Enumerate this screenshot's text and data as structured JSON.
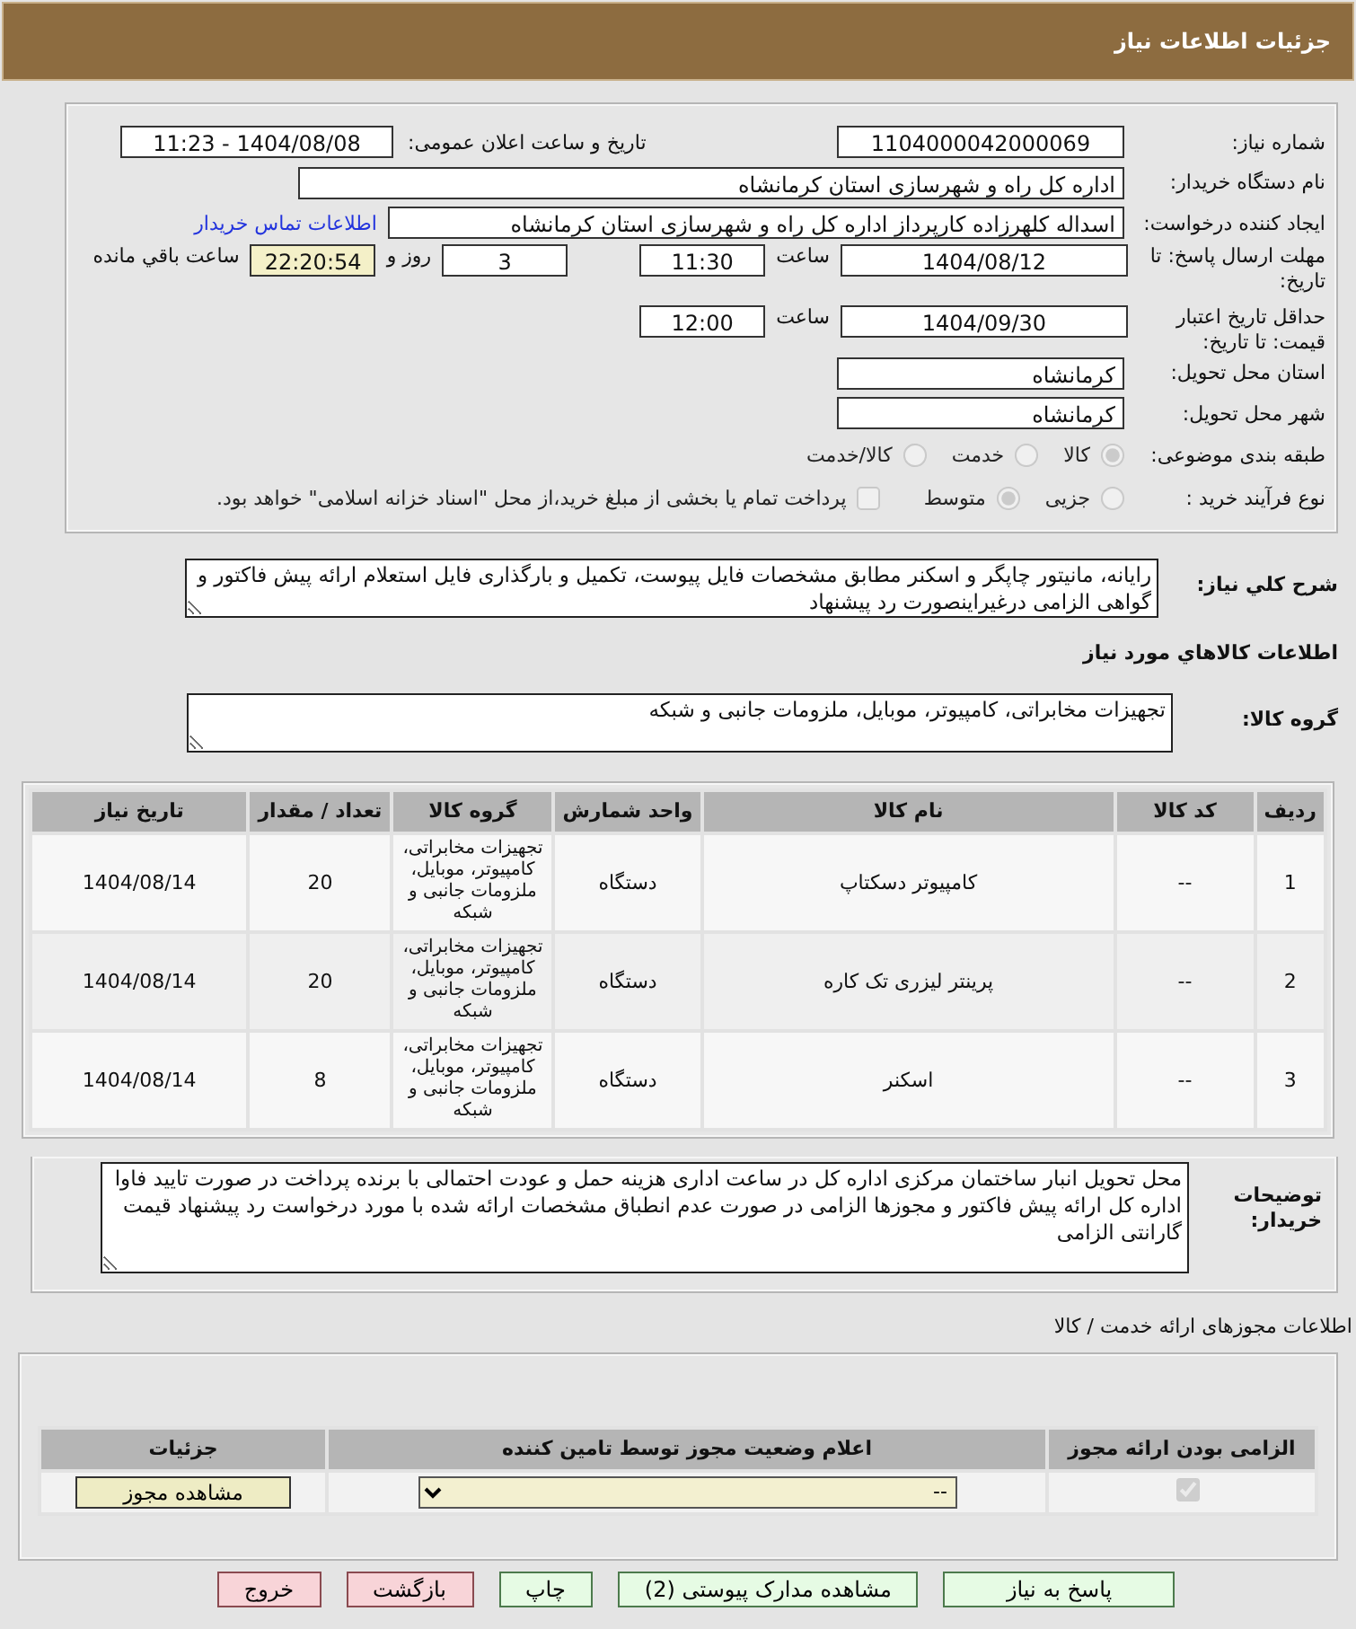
{
  "header": {
    "title": "جزئیات اطلاعات نیاز"
  },
  "form": {
    "need_number": {
      "label": "شماره نیاز:",
      "value": "1104000042000069"
    },
    "announce": {
      "label": "تاریخ و ساعت اعلان عمومی:",
      "value": "1404/08/08 - 11:23"
    },
    "buyer": {
      "label": "نام دستگاه خریدار:",
      "value": "اداره کل راه و شهرسازی استان کرمانشاه"
    },
    "requester": {
      "label": "ایجاد کننده درخواست:",
      "value": "اسداله کلهرزاده کارپرداز اداره کل راه و شهرسازی استان کرمانشاه",
      "link": "اطلاعات تماس خریدار"
    },
    "deadline": {
      "label": "مهلت ارسال پاسخ: تا تاریخ:",
      "date": "1404/08/12",
      "time_label": "ساعت",
      "time": "11:30",
      "days": "3",
      "days_label": "روز و",
      "remaining": "22:20:54",
      "remaining_label": "ساعت باقي مانده"
    },
    "validity": {
      "label": "حداقل تاریخ اعتبار قیمت: تا تاریخ:",
      "date": "1404/09/30",
      "time_label": "ساعت",
      "time": "12:00"
    },
    "province": {
      "label": "استان محل تحویل:",
      "value": "کرمانشاه"
    },
    "city": {
      "label": "شهر محل تحویل:",
      "value": "کرمانشاه"
    },
    "category": {
      "label": "طبقه بندی موضوعی:",
      "options": [
        {
          "label": "کالا",
          "selected": true
        },
        {
          "label": "خدمت",
          "selected": false
        },
        {
          "label": "کالا/خدمت",
          "selected": false
        }
      ]
    },
    "process": {
      "label": "نوع فرآیند خرید :",
      "options": [
        {
          "label": "جزیی",
          "selected": false
        },
        {
          "label": "متوسط",
          "selected": true
        }
      ],
      "payment": {
        "label": "پرداخت تمام یا بخشی از مبلغ خرید،از محل \"اسناد خزانه اسلامی\" خواهد بود.",
        "checked": false
      }
    }
  },
  "description": {
    "label": "شرح کلي نياز:",
    "value": "رایانه، مانیتور چاپگر و اسکنر مطابق مشخصات فایل پیوست، تکمیل و بارگذاری فایل استعلام ارائه پیش فاکتور و گواهی الزامی درغیراینصورت رد پیشنهاد"
  },
  "goods_title": "اطلاعات کالاهاي مورد نياز",
  "goods_group": {
    "label": "گروه کالا:",
    "value": "تجهیزات مخابراتی، کامپیوتر، موبایل، ملزومات جانبی و شبکه"
  },
  "items": {
    "columns": [
      "رديف",
      "کد کالا",
      "نام کالا",
      "واحد شمارش",
      "گروه کالا",
      "تعداد / مقدار",
      "تاریخ نیاز"
    ],
    "rows": [
      [
        "1",
        "--",
        "کامپیوتر دسکتاپ",
        "دستگاه",
        "تجهیزات مخابراتی، کامپیوتر، موبایل، ملزومات جانبی و شبکه",
        "20",
        "1404/08/14"
      ],
      [
        "2",
        "--",
        "پرینتر لیزری تک کاره",
        "دستگاه",
        "تجهیزات مخابراتی، کامپیوتر، موبایل، ملزومات جانبی و شبکه",
        "20",
        "1404/08/14"
      ],
      [
        "3",
        "--",
        "اسکنر",
        "دستگاه",
        "تجهیزات مخابراتی، کامپیوتر، موبایل، ملزومات جانبی و شبکه",
        "8",
        "1404/08/14"
      ]
    ]
  },
  "buyer_notes": {
    "label": "توضیحات خریدار:",
    "value": "محل تحویل انبار ساختمان مرکزی اداره کل در ساعت اداری هزینه حمل و عودت احتمالی با برنده پرداخت در صورت تایید فاوا اداره کل ارائه پیش فاکتور و مجوزها الزامی در صورت عدم انطباق مشخصات ارائه شده با مورد درخواست رد پیشنهاد قیمت گارانتی الزامی"
  },
  "permits": {
    "title": "اطلاعات مجوزهای ارائه خدمت / کالا",
    "columns": [
      "الزامی بودن ارائه مجوز",
      "اعلام وضعیت مجوز توسط تامین کننده",
      "جزئیات"
    ],
    "rows": [
      {
        "required": true,
        "status": "--",
        "button": "مشاهده مجوز"
      }
    ]
  },
  "actions": [
    {
      "label": "پاسخ به نیاز",
      "kind": "green"
    },
    {
      "label": "مشاهده مدارک پیوستی (2)",
      "kind": "green"
    },
    {
      "label": "چاپ",
      "kind": "green"
    },
    {
      "label": "بازگشت",
      "kind": "red"
    },
    {
      "label": "خروج",
      "kind": "red"
    }
  ]
}
